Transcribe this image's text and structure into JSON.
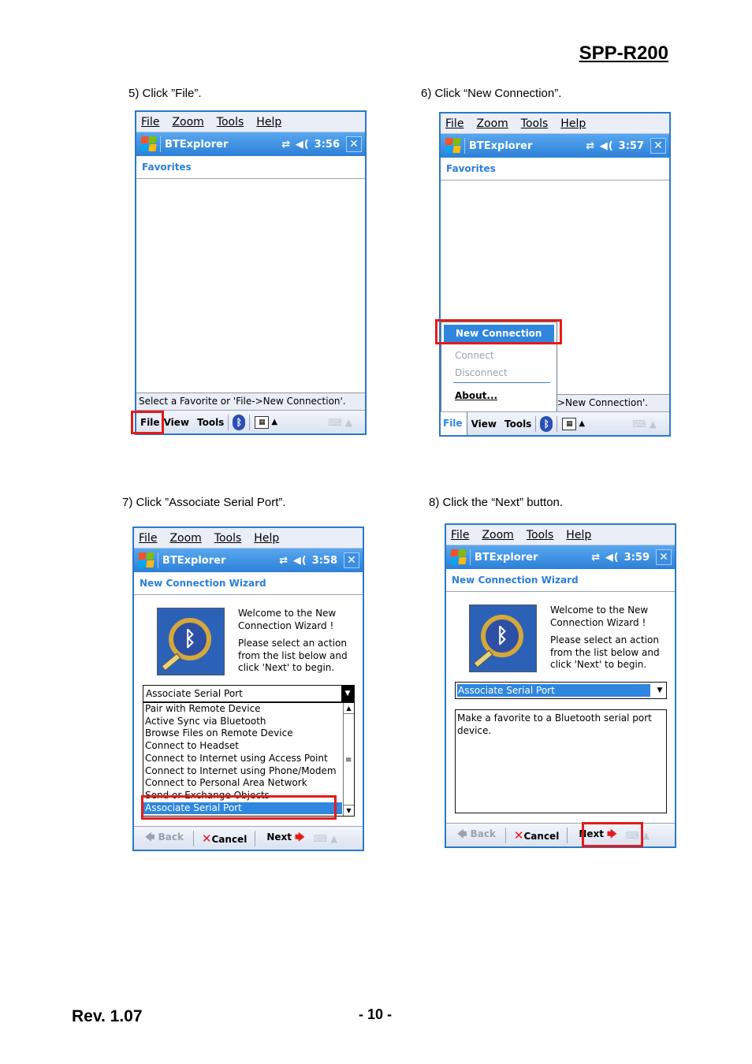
{
  "header": {
    "model": "SPP-R200"
  },
  "steps": {
    "s5": "5) Click ”File”.",
    "s6": "6) Click “New Connection”.",
    "s7": "7) Click ”Associate Serial Port”.",
    "s8": "8) Click the “Next” button."
  },
  "menubar": {
    "file": "File",
    "zoom": "Zoom",
    "tools": "Tools",
    "help": "Help"
  },
  "app": {
    "title": "BTExplorer",
    "tray_icons": "⇄ ◀(",
    "close": "✕"
  },
  "screens": {
    "s5": {
      "time": "3:56",
      "heading": "Favorites",
      "status": "Select a Favorite or 'File->New Connection'.",
      "bottom": {
        "file": "File",
        "view": "View",
        "tools": "Tools"
      }
    },
    "s6": {
      "time": "3:57",
      "heading": "Favorites",
      "status": ">New Connection'.",
      "bottom": {
        "file": "File",
        "view": "View",
        "tools": "Tools"
      },
      "menu": {
        "new_connection": "New Connection",
        "connect": "Connect",
        "disconnect": "Disconnect",
        "about": "About..."
      }
    },
    "s7": {
      "time": "3:58",
      "heading": "New Connection Wizard"
    },
    "s8": {
      "time": "3:59",
      "heading": "New Connection Wizard",
      "description": "Make a favorite to a Bluetooth serial port device."
    }
  },
  "wizard": {
    "welcome": "Welcome to the New Connection Wizard !",
    "instruction": "Please select an action from the list below and click 'Next' to begin.",
    "selected_action": "Associate Serial Port",
    "actions": [
      "Pair with Remote Device",
      "Active Sync via Bluetooth",
      "Browse Files on Remote Device",
      "Connect to Headset",
      "Connect to Internet using Access Point",
      "Connect to Internet using Phone/Modem",
      "Connect to Personal Area Network",
      "Send or Exchange Objects",
      "Associate Serial Port"
    ],
    "back": "Back",
    "cancel": "Cancel",
    "next": "Next"
  },
  "footer": {
    "revision": "Rev. 1.07",
    "page": "- 10 -"
  },
  "colors": {
    "accent_blue": "#2e86de",
    "highlight_red": "#e41b1b",
    "heading_blue": "#2d7fd4"
  }
}
